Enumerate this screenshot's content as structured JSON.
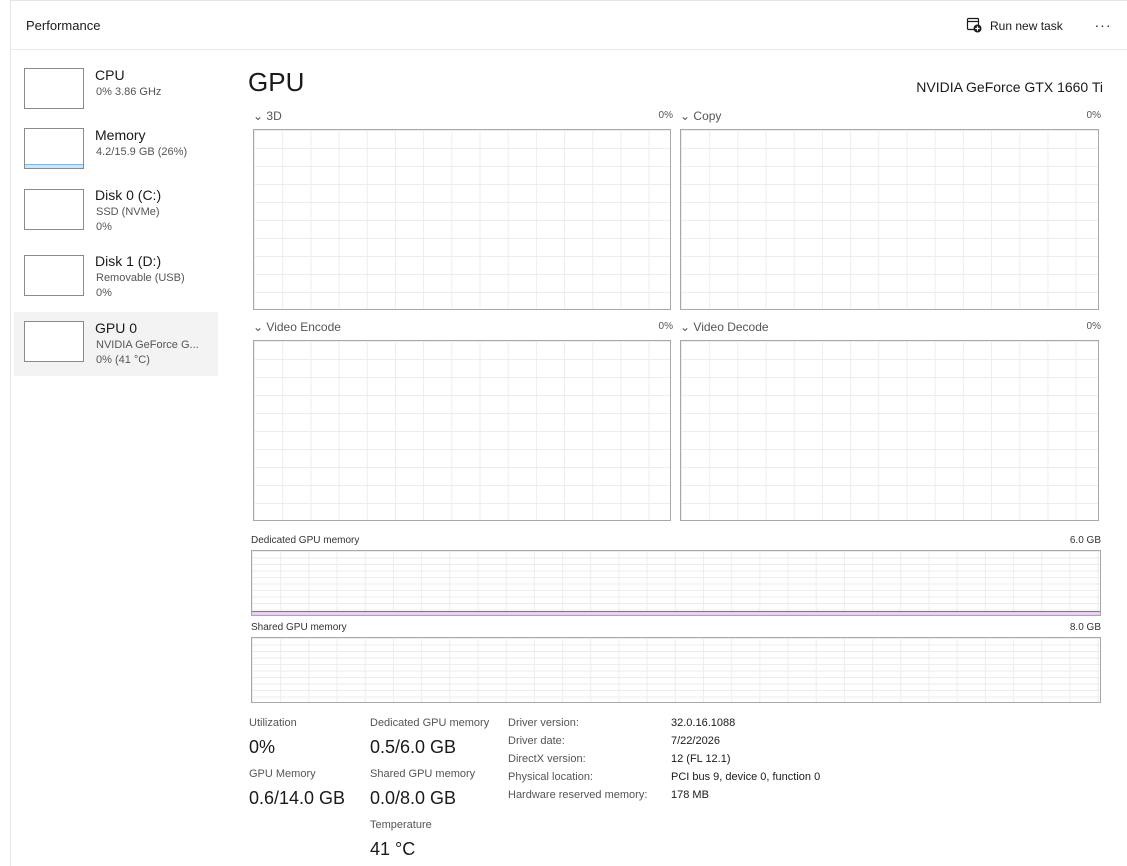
{
  "header": {
    "title": "Performance",
    "run_task_label": "Run new task",
    "more_label": "···"
  },
  "sidebar": {
    "items": [
      {
        "name": "CPU",
        "line1": "0% 3.86 GHz",
        "line2": "",
        "fill_percent": 0
      },
      {
        "name": "Memory",
        "line1": "4.2/15.9 GB (26%)",
        "line2": "",
        "fill_percent": 26
      },
      {
        "name": "Disk 0 (C:)",
        "line1": "SSD (NVMe)",
        "line2": "0%",
        "fill_percent": 0
      },
      {
        "name": "Disk 1 (D:)",
        "line1": "Removable (USB)",
        "line2": "0%",
        "fill_percent": 0
      },
      {
        "name": "GPU 0",
        "line1": "NVIDIA GeForce G...",
        "line2": "0% (41 °C)",
        "fill_percent": 0
      }
    ]
  },
  "main": {
    "title": "GPU",
    "model": "NVIDIA GeForce GTX 1660 Ti",
    "engines": [
      {
        "label": "3D",
        "percent": "0%"
      },
      {
        "label": "Copy",
        "percent": "0%"
      },
      {
        "label": "Video Encode",
        "percent": "0%"
      },
      {
        "label": "Video Decode",
        "percent": "0%"
      }
    ],
    "dedicated_memory": {
      "label": "Dedicated GPU memory",
      "max": "6.0 GB",
      "fill_fraction": 0.083
    },
    "shared_memory": {
      "label": "Shared GPU memory",
      "max": "8.0 GB",
      "fill_fraction": 0
    }
  },
  "stats": {
    "utilization_label": "Utilization",
    "utilization_value": "0%",
    "dedicated_label": "Dedicated GPU memory",
    "dedicated_value": "0.5/6.0 GB",
    "gpu_memory_label": "GPU Memory",
    "gpu_memory_value": "0.6/14.0 GB",
    "shared_label": "Shared GPU memory",
    "shared_value": "0.0/8.0 GB",
    "temperature_label": "Temperature",
    "temperature_value": "41 °C"
  },
  "details": [
    {
      "key": "Driver version:",
      "value": "32.0.16.1088"
    },
    {
      "key": "Driver date:",
      "value": "7/22/2026"
    },
    {
      "key": "DirectX version:",
      "value": "12 (FL 12.1)"
    },
    {
      "key": "Physical location:",
      "value": "PCI bus 9, device 0, function 0"
    },
    {
      "key": "Hardware reserved memory:",
      "value": "178 MB"
    }
  ],
  "colors": {
    "memory_fill": "#cfe4f7",
    "gpu_memory_line": "#9b59c9",
    "selected_bg": "#f3f3f3"
  },
  "icons": [
    "run-task-icon",
    "more-options-icon",
    "chevron-down-icon"
  ]
}
